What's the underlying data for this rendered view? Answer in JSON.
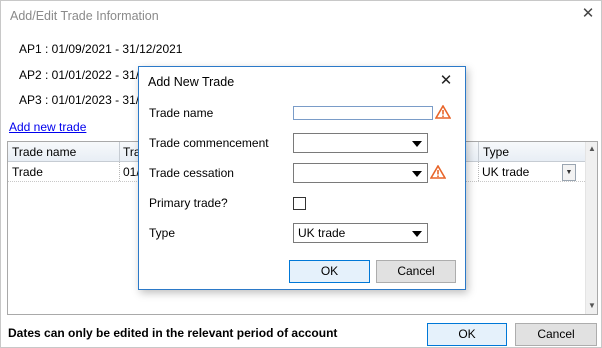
{
  "outer": {
    "title": "Add/Edit Trade Information",
    "periods": [
      "AP1 : 01/09/2021 - 31/12/2021",
      "AP2 : 01/01/2022 - 31/12",
      "AP3 : 01/01/2023 - 31/01"
    ],
    "add_link": "Add new trade",
    "grid": {
      "headers": [
        "Trade name",
        "Tra",
        "Type"
      ],
      "row": {
        "name": "Trade",
        "period": "01/",
        "type": "UK trade"
      }
    },
    "note": "Dates can only be edited in the relevant period of account",
    "ok_label": "OK",
    "cancel_label": "Cancel"
  },
  "modal": {
    "title": "Add New Trade",
    "trade_name_label": "Trade name",
    "trade_name_value": "",
    "commencement_label": "Trade commencement",
    "commencement_value": "",
    "cessation_label": "Trade cessation",
    "cessation_value": "",
    "primary_label": "Primary trade?",
    "primary_checked": false,
    "type_label": "Type",
    "type_value": "UK trade",
    "ok_label": "OK",
    "cancel_label": "Cancel"
  },
  "colors": {
    "accent": "#0078d7",
    "warning": "#e8652a",
    "link": "#0000ee"
  }
}
